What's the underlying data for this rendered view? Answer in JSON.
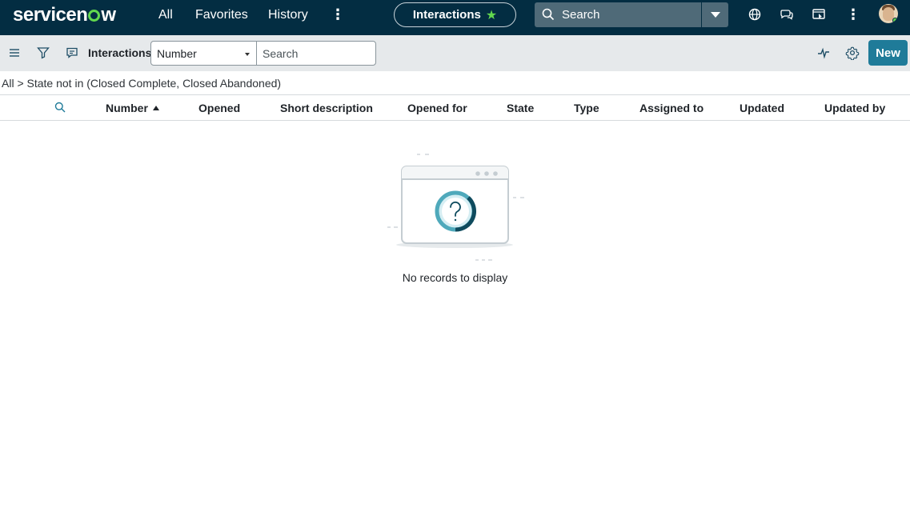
{
  "topnav": {
    "brand": "servicenow",
    "links": [
      "All",
      "Favorites",
      "History"
    ],
    "pill_label": "Interactions",
    "search_placeholder": "Search",
    "icons": [
      "globe-icon",
      "chat-icon",
      "dev-console-icon",
      "more-icon"
    ],
    "colors": {
      "bg": "#032d42",
      "accent": "#62d84e"
    }
  },
  "toolbar": {
    "list_title": "Interactions",
    "field_select_value": "Number",
    "search_placeholder": "Search",
    "new_label": "New",
    "icons": [
      "menu-icon",
      "filter-icon",
      "chat-bubble-icon",
      "activity-icon",
      "gear-icon"
    ],
    "colors": {
      "bg": "#e6e9eb",
      "primary": "#1f7b99"
    }
  },
  "breadcrumb": {
    "root": "All",
    "separator": ">",
    "condition": "State not in (Closed Complete, Closed Abandoned)"
  },
  "columns": [
    "Number",
    "Opened",
    "Short description",
    "Opened for",
    "State",
    "Type",
    "Assigned to",
    "Updated",
    "Updated by"
  ],
  "sort": {
    "column": "Number",
    "direction": "ascending"
  },
  "empty": {
    "message": "No records to display"
  }
}
